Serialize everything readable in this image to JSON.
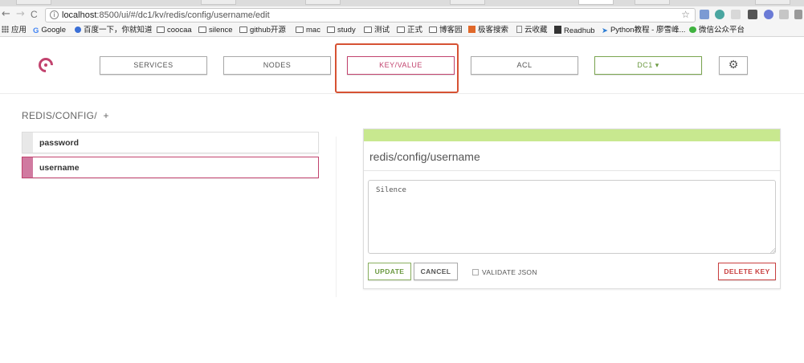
{
  "browser": {
    "url_host": "localhost",
    "url_rest": ":8500/ui/#/dc1/kv/redis/config/username/edit",
    "back_icon": "←",
    "forward_icon": "→",
    "reload_icon": "C",
    "info_icon": "i",
    "star_icon": "☆",
    "bookmarks": [
      {
        "label": "应用",
        "icon": "apps-icon"
      },
      {
        "label": "Google",
        "icon": "google-icon"
      },
      {
        "label": "百度一下，你就知道",
        "icon": "baidu-icon"
      },
      {
        "label": "coocaa",
        "icon": "folder-icon"
      },
      {
        "label": "silence",
        "icon": "folder-icon"
      },
      {
        "label": "github开源",
        "icon": "folder-icon"
      },
      {
        "label": "mac",
        "icon": "folder-icon"
      },
      {
        "label": "study",
        "icon": "folder-icon"
      },
      {
        "label": "测试",
        "icon": "folder-icon"
      },
      {
        "label": "正式",
        "icon": "folder-icon"
      },
      {
        "label": "博客园",
        "icon": "folder-icon"
      },
      {
        "label": "极客搜索",
        "icon": "jike-icon"
      },
      {
        "label": "云收藏",
        "icon": "page-icon"
      },
      {
        "label": "Readhub",
        "icon": "readhub-icon"
      },
      {
        "label": "Python教程 - 廖雪峰...",
        "icon": "rocket-icon"
      },
      {
        "label": "微信公众平台",
        "icon": "wechat-icon"
      }
    ]
  },
  "nav": {
    "services": "SERVICES",
    "nodes": "NODES",
    "kv": "KEY/VALUE",
    "acl": "ACL",
    "dc": "DC1 ▾",
    "settings_icon": "⚙"
  },
  "colors": {
    "accent": "#c2436e",
    "highlight": "#d65233",
    "success": "#6c9a42",
    "strip": "#c8e88f",
    "danger": "#c94040"
  },
  "kv": {
    "breadcrumb": "REDIS/CONFIG/",
    "add": "+",
    "keys": [
      {
        "label": "password",
        "active": false
      },
      {
        "label": "username",
        "active": true
      }
    ]
  },
  "editor": {
    "title": "redis/config/username",
    "value": "Silence",
    "update": "UPDATE",
    "cancel": "CANCEL",
    "validate": "VALIDATE JSON",
    "delete": "DELETE KEY"
  }
}
